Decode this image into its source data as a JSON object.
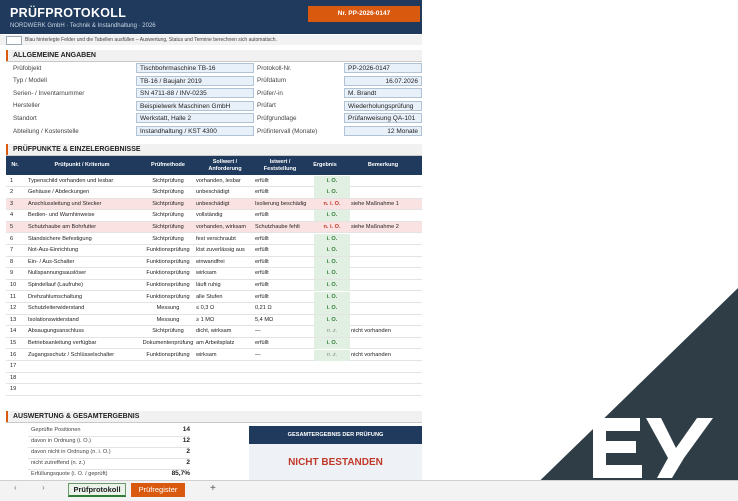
{
  "header": {
    "title": "PRÜFPROTOKOLL",
    "subtitle": "NORDWERK GmbH · Technik & Instandhaltung · 2026",
    "protocol_badge": "Nr. PP-2026-0147"
  },
  "hint": "Blau hinterlegte Felder und die Tabellen ausfüllen – Auswertung, Status und Termine berechnen sich automatisch.",
  "general": {
    "heading": "ALLGEMEINE ANGABEN",
    "left": [
      {
        "label": "Prüfobjekt",
        "value": "Tischbohrmaschine TB-16"
      },
      {
        "label": "Typ / Modell",
        "value": "TB-16 / Baujahr 2019"
      },
      {
        "label": "Serien- / Inventarnummer",
        "value": "SN 4711-88 / INV-0235"
      },
      {
        "label": "Hersteller",
        "value": "Beispielwerk Maschinen GmbH"
      },
      {
        "label": "Standort",
        "value": "Werkstatt, Halle 2"
      },
      {
        "label": "Abteilung / Kostenstelle",
        "value": "Instandhaltung / KST 4300"
      }
    ],
    "right": [
      {
        "label": "Protokoll-Nr.",
        "value": "PP-2026-0147"
      },
      {
        "label": "Prüfdatum",
        "value": "16.07.2026"
      },
      {
        "label": "Prüfer/-in",
        "value": "M. Brandt"
      },
      {
        "label": "Prüfart",
        "value": "Wiederholungsprüfung"
      },
      {
        "label": "Prüfgrundlage",
        "value": "Prüfanweisung QA-101"
      },
      {
        "label": "Prüfintervall (Monate)",
        "value": "12 Monate"
      }
    ]
  },
  "checks": {
    "heading": "PRÜFPUNKTE & EINZELERGEBNISSE",
    "columns": [
      "Nr.",
      "Prüfpunkt / Kriterium",
      "Prüfmethode",
      "Sollwert / Anforderung",
      "Istwert / Feststellung",
      "Ergebnis",
      "Bemerkung"
    ],
    "rows": [
      {
        "nr": "1",
        "item": "Typenschild vorhanden und lesbar",
        "method": "Sichtprüfung",
        "target": "vorhanden, lesbar",
        "actual": "erfüllt",
        "result": "i. O.",
        "status": "ok",
        "note": ""
      },
      {
        "nr": "2",
        "item": "Gehäuse / Abdeckungen",
        "method": "Sichtprüfung",
        "target": "unbeschädigt",
        "actual": "erfüllt",
        "result": "i. O.",
        "status": "ok",
        "note": ""
      },
      {
        "nr": "3",
        "item": "Anschlussleitung und Stecker",
        "method": "Sichtprüfung",
        "target": "unbeschädigt",
        "actual": "Isolierung beschädigt",
        "result": "n. i. O.",
        "status": "fail",
        "note": "siehe Maßnahme 1"
      },
      {
        "nr": "4",
        "item": "Bedien- und Warnhinweise",
        "method": "Sichtprüfung",
        "target": "vollständig",
        "actual": "erfüllt",
        "result": "i. O.",
        "status": "ok",
        "note": ""
      },
      {
        "nr": "5",
        "item": "Schutzhaube am Bohrfutter",
        "method": "Sichtprüfung",
        "target": "vorhanden, wirksam",
        "actual": "Schutzhaube fehlt",
        "result": "n. i. O.",
        "status": "fail",
        "note": "siehe Maßnahme 2"
      },
      {
        "nr": "6",
        "item": "Standsichere Befestigung",
        "method": "Sichtprüfung",
        "target": "fest verschraubt",
        "actual": "erfüllt",
        "result": "i. O.",
        "status": "ok",
        "note": ""
      },
      {
        "nr": "7",
        "item": "Not-Aus-Einrichtung",
        "method": "Funktionsprüfung",
        "target": "löst zuverlässig aus",
        "actual": "erfüllt",
        "result": "i. O.",
        "status": "ok",
        "note": ""
      },
      {
        "nr": "8",
        "item": "Ein- / Aus-Schalter",
        "method": "Funktionsprüfung",
        "target": "einwandfrei",
        "actual": "erfüllt",
        "result": "i. O.",
        "status": "ok",
        "note": ""
      },
      {
        "nr": "9",
        "item": "Nullspannungsauslöser",
        "method": "Funktionsprüfung",
        "target": "wirksam",
        "actual": "erfüllt",
        "result": "i. O.",
        "status": "ok",
        "note": ""
      },
      {
        "nr": "10",
        "item": "Spindellauf (Laufruhe)",
        "method": "Funktionsprüfung",
        "target": "läuft ruhig",
        "actual": "erfüllt",
        "result": "i. O.",
        "status": "ok",
        "note": ""
      },
      {
        "nr": "11",
        "item": "Drehzahlumschaltung",
        "method": "Funktionsprüfung",
        "target": "alle Stufen",
        "actual": "erfüllt",
        "result": "i. O.",
        "status": "ok",
        "note": ""
      },
      {
        "nr": "12",
        "item": "Schutzleiterwiderstand",
        "method": "Messung",
        "target": "≤ 0,3 Ω",
        "actual": "0,21 Ω",
        "result": "i. O.",
        "status": "ok",
        "note": ""
      },
      {
        "nr": "13",
        "item": "Isolationswiderstand",
        "method": "Messung",
        "target": "≥ 1 MΩ",
        "actual": "5,4 MΩ",
        "result": "i. O.",
        "status": "ok",
        "note": ""
      },
      {
        "nr": "14",
        "item": "Absaugungsanschluss",
        "method": "Sichtprüfung",
        "target": "dicht, wirksam",
        "actual": "—",
        "result": "n. z.",
        "status": "na",
        "note": "nicht vorhanden"
      },
      {
        "nr": "15",
        "item": "Betriebsanleitung verfügbar",
        "method": "Dokumentenprüfung",
        "target": "am Arbeitsplatz",
        "actual": "erfüllt",
        "result": "i. O.",
        "status": "ok",
        "note": ""
      },
      {
        "nr": "16",
        "item": "Zugangsschutz / Schlüsselschalter",
        "method": "Funktionsprüfung",
        "target": "wirksam",
        "actual": "—",
        "result": "n. z.",
        "status": "na",
        "note": "nicht vorhanden"
      },
      {
        "nr": "17",
        "item": "",
        "method": "",
        "target": "",
        "actual": "",
        "result": "",
        "status": "empty",
        "note": ""
      },
      {
        "nr": "18",
        "item": "",
        "method": "",
        "target": "",
        "actual": "",
        "result": "",
        "status": "empty",
        "note": ""
      },
      {
        "nr": "19",
        "item": "",
        "method": "",
        "target": "",
        "actual": "",
        "result": "",
        "status": "empty",
        "note": ""
      }
    ]
  },
  "evaluation": {
    "heading": "AUSWERTUNG & GESAMTERGEBNIS",
    "items": [
      {
        "label": "Geprüfte Positionen",
        "value": "14"
      },
      {
        "label": "davon in Ordnung (i. O.)",
        "value": "12"
      },
      {
        "label": "davon nicht in Ordnung (n. i. O.)",
        "value": "2"
      },
      {
        "label": "nicht zutreffend (n. z.)",
        "value": "2"
      },
      {
        "label": "Erfüllungsquote (i. O. / geprüft)",
        "value": "85,7%"
      }
    ],
    "result_heading": "GESAMTERGEBNIS DER PRÜFUNG",
    "result_value": "NICHT BESTANDEN"
  },
  "tabs": {
    "nav_prev": "‹",
    "nav_next": "›",
    "sheet1": "Prüfprotokoll",
    "sheet2": "Prüfregister",
    "add": "+"
  },
  "colors": {
    "navy": "#1f3a5c",
    "accent_orange": "#d9590f",
    "ok_green": "#2e7d32",
    "fail_red": "#c0392b"
  }
}
